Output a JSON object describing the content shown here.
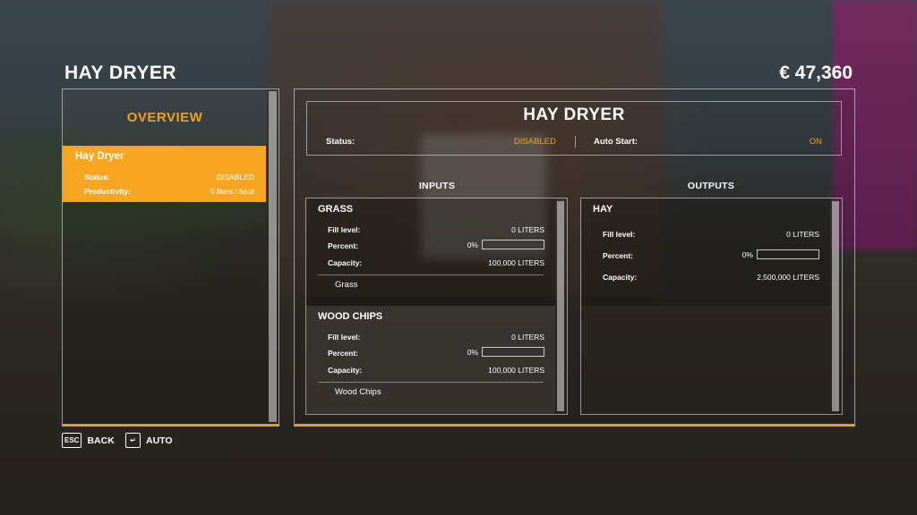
{
  "header": {
    "title": "HAY DRYER",
    "money": "€ 47,360"
  },
  "sidebar": {
    "title": "OVERVIEW",
    "items": [
      {
        "name": "Hay Dryer",
        "status_label": "Status:",
        "status_value": "DISABLED",
        "productivity_label": "Productivity:",
        "productivity_value": "0 liters / hour"
      }
    ]
  },
  "info": {
    "title": "HAY DRYER",
    "status_label": "Status:",
    "status_value": "DISABLED",
    "autostart_label": "Auto Start:",
    "autostart_value": "ON"
  },
  "inputs": {
    "heading": "INPUTS",
    "items": [
      {
        "name": "GRASS",
        "fill_label": "Fill level:",
        "fill_value": "0 LITERS",
        "percent_label": "Percent:",
        "percent_value": "0%",
        "percent_fraction": 0,
        "capacity_label": "Capacity:",
        "capacity_value": "100,000 LITERS",
        "fill_type": "Grass"
      },
      {
        "name": "WOOD CHIPS",
        "fill_label": "Fill level:",
        "fill_value": "0 LITERS",
        "percent_label": "Percent:",
        "percent_value": "0%",
        "percent_fraction": 0,
        "capacity_label": "Capacity:",
        "capacity_value": "100,000 LITERS",
        "fill_type": "Wood Chips"
      }
    ]
  },
  "outputs": {
    "heading": "OUTPUTS",
    "items": [
      {
        "name": "HAY",
        "fill_label": "Fill level:",
        "fill_value": "0 LITERS",
        "percent_label": "Percent:",
        "percent_value": "0%",
        "percent_fraction": 0,
        "capacity_label": "Capacity:",
        "capacity_value": "2,500,000 LITERS"
      }
    ]
  },
  "footer": {
    "back_key": "ESC",
    "back_label": "BACK",
    "auto_key": "↵",
    "auto_label": "AUTO"
  },
  "colors": {
    "accent": "#f0a21c",
    "selected": "#f6a623"
  }
}
